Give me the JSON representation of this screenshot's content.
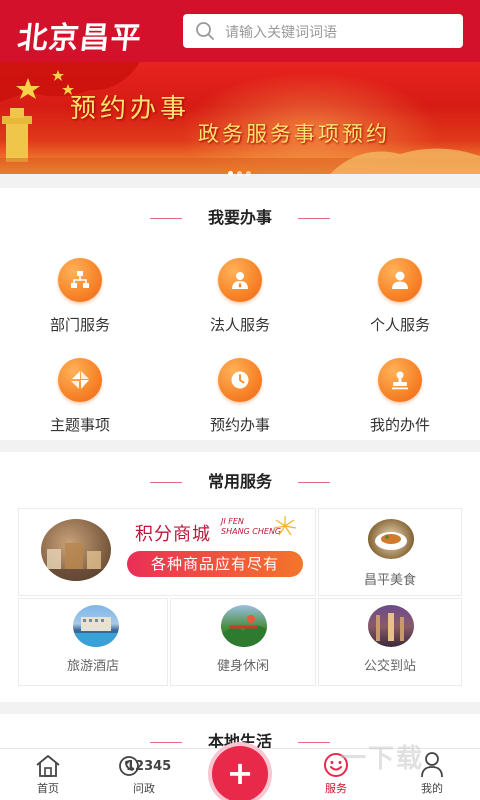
{
  "header": {
    "logo": "北京昌平",
    "search_placeholder": "请输入关键词词语"
  },
  "banner": {
    "title": "预约办事",
    "subtitle": "政务服务事项预约",
    "dots": 3
  },
  "section_work": {
    "title": "我要办事",
    "items": [
      {
        "label": "部门服务",
        "icon": "department-icon"
      },
      {
        "label": "法人服务",
        "icon": "legal-person-icon"
      },
      {
        "label": "个人服务",
        "icon": "person-icon"
      },
      {
        "label": "主题事项",
        "icon": "topic-icon"
      },
      {
        "label": "预约办事",
        "icon": "clock-icon"
      },
      {
        "label": "我的办件",
        "icon": "stamp-icon"
      }
    ]
  },
  "section_common": {
    "title": "常用服务",
    "mall_title": "积分商城",
    "mall_pinyin_1": "JI FEN",
    "mall_pinyin_2": "SHANG CHENG",
    "mall_slogan": "各种商品应有尽有",
    "items": [
      {
        "label": "昌平美食"
      },
      {
        "label": "旅游酒店"
      },
      {
        "label": "健身休闲"
      },
      {
        "label": "公交到站"
      }
    ]
  },
  "section_local": {
    "title": "本地生活"
  },
  "bottom_nav": {
    "items": [
      {
        "label": "首页",
        "icon": "home-icon"
      },
      {
        "label": "问政",
        "icon": "hotline-12345-icon",
        "icon_text": "12345"
      },
      {
        "label": "",
        "icon": "plus-icon",
        "icon_text": "+"
      },
      {
        "label": "服务",
        "icon": "smile-icon"
      },
      {
        "label": "我的",
        "icon": "user-icon"
      }
    ],
    "active_index": 3
  },
  "watermark": "一下载",
  "colors": {
    "primary_red": "#d4112a",
    "icon_orange": "#f7872b",
    "slogan_red": "#e8294a"
  }
}
